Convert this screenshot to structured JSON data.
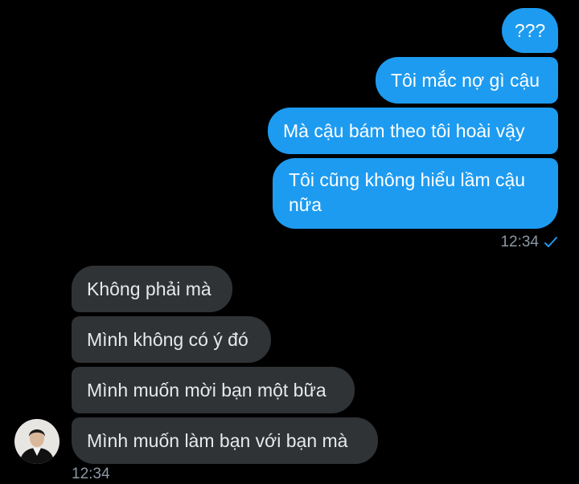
{
  "conversation": {
    "sent": [
      {
        "text": "???"
      },
      {
        "text": "Tôi mắc nợ gì cậu"
      },
      {
        "text": "Mà cậu bám theo tôi hoài vậy"
      },
      {
        "text": "Tôi cũng không hiểu lầm cậu nữa"
      }
    ],
    "sent_time": "12:34",
    "sent_status_icon": "check-icon",
    "received": [
      {
        "text": "Không phải mà"
      },
      {
        "text": "Mình không có ý đó"
      },
      {
        "text": "Mình muốn mời bạn một bữa"
      },
      {
        "text": "Mình muốn làm bạn với bạn mà"
      }
    ],
    "received_time": "12:34",
    "avatar_icon": "avatar"
  },
  "colors": {
    "background": "#000000",
    "sent_bubble": "#1d9bf0",
    "received_bubble": "#2f3336",
    "timestamp": "#8b98a5"
  }
}
